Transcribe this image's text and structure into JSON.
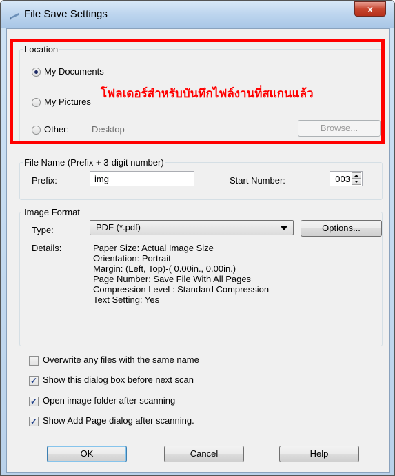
{
  "window": {
    "title": "File Save Settings",
    "close_label": "x"
  },
  "location": {
    "legend": "Location",
    "options": [
      {
        "label": "My Documents",
        "selected": true
      },
      {
        "label": "My Pictures",
        "selected": false
      },
      {
        "label": "Other:",
        "selected": false
      }
    ],
    "other_path": "Desktop",
    "browse_label": "Browse...",
    "annotation": "โฟลเดอร์สำหรับบันทึกไฟล์งานที่สแกนแล้ว"
  },
  "file_name": {
    "legend": "File Name (Prefix + 3-digit number)",
    "prefix_label": "Prefix:",
    "prefix_value": "img",
    "start_label": "Start Number:",
    "start_value": "003"
  },
  "image_format": {
    "legend": "Image Format",
    "type_label": "Type:",
    "type_value": "PDF (*.pdf)",
    "options_label": "Options...",
    "details_label": "Details:",
    "details": [
      "Paper Size: Actual Image Size",
      "Orientation: Portrait",
      "Margin: (Left, Top)-( 0.00in., 0.00in.)",
      "Page Number: Save File With All Pages",
      "Compression Level : Standard Compression",
      "Text Setting: Yes"
    ]
  },
  "checkboxes": [
    {
      "label": "Overwrite any files with the same name",
      "checked": false
    },
    {
      "label": "Show this dialog box before next scan",
      "checked": true
    },
    {
      "label": "Open image folder after scanning",
      "checked": true
    },
    {
      "label": "Show Add Page dialog after scanning.",
      "checked": true
    }
  ],
  "buttons": {
    "ok": "OK",
    "cancel": "Cancel",
    "help": "Help"
  },
  "icons": {
    "app": "scanner-icon",
    "close": "close-icon",
    "check": "checkmark-icon",
    "spin": "spinner-arrows-icon",
    "dropdown": "chevron-down-icon"
  },
  "colors": {
    "annotation": "#ff0000",
    "titlebar": "#bdd5ee"
  }
}
